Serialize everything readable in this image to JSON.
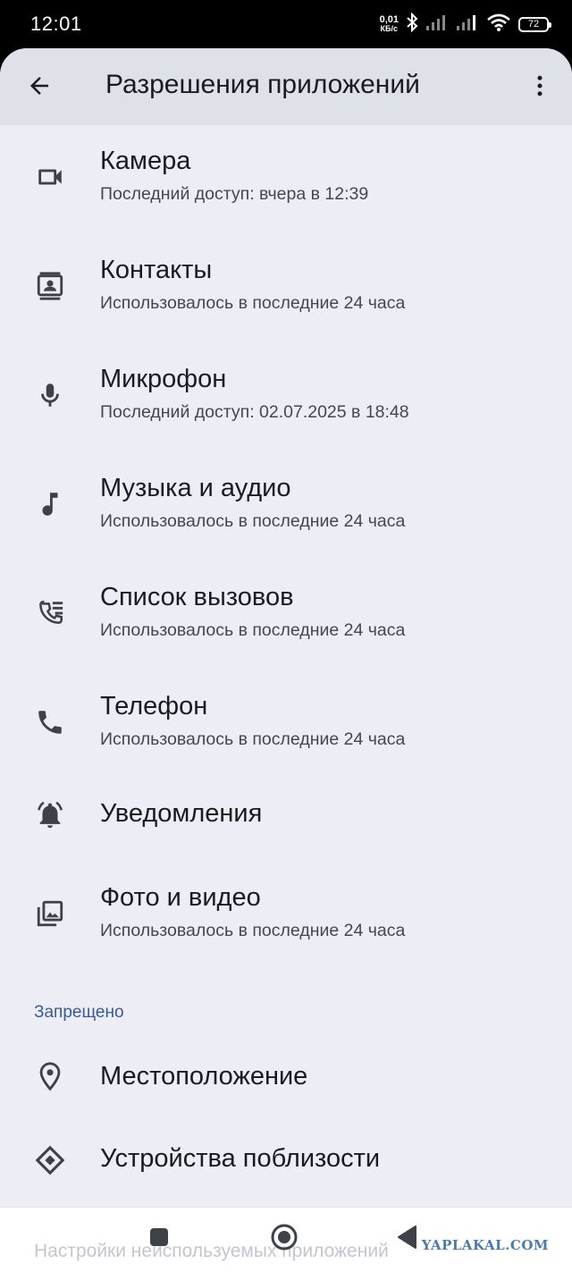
{
  "status_bar": {
    "time": "12:01",
    "net_speed_value": "0,01",
    "net_speed_unit": "КБ/с",
    "battery_level": "72",
    "icons": [
      "bluetooth-icon",
      "signal-icon",
      "signal-icon",
      "wifi-icon",
      "battery-icon"
    ]
  },
  "header": {
    "title": "Разрешения приложений",
    "back_icon": "arrow-back-icon",
    "menu_icon": "more-vert-icon"
  },
  "allowed": [
    {
      "title": "Камера",
      "subtitle": "Последний доступ: вчера в 12:39",
      "icon": "camera-icon"
    },
    {
      "title": "Контакты",
      "subtitle": "Использовалось в последние 24 часа",
      "icon": "contacts-icon"
    },
    {
      "title": "Микрофон",
      "subtitle": "Последний доступ: 02.07.2025 в 18:48",
      "icon": "microphone-icon"
    },
    {
      "title": "Музыка и аудио",
      "subtitle": "Использовалось в последние 24 часа",
      "icon": "music-note-icon"
    },
    {
      "title": "Список вызовов",
      "subtitle": "Использовалось в последние 24 часа",
      "icon": "call-log-icon"
    },
    {
      "title": "Телефон",
      "subtitle": "Использовалось в последние 24 часа",
      "icon": "phone-icon"
    },
    {
      "title": "Уведомления",
      "subtitle": "",
      "icon": "notification-bell-icon"
    },
    {
      "title": "Фото и видео",
      "subtitle": "Использовалось в последние 24 часа",
      "icon": "photo-library-icon"
    }
  ],
  "denied_section": {
    "header": "Запрещено",
    "items": [
      {
        "title": "Местоположение",
        "icon": "location-pin-icon"
      },
      {
        "title": "Устройства поблизости",
        "icon": "nearby-devices-icon"
      }
    ]
  },
  "faded_item": "Настройки неиспользуемых приложений",
  "nav_bar": {
    "icons": [
      "recents-square-icon",
      "home-circle-icon",
      "back-triangle-icon"
    ]
  },
  "watermark": "YAPLAKAL.COM",
  "colors": {
    "background": "#edeef5",
    "app_bar": "#dfe1e9",
    "section_header": "#3a5a9a",
    "text_primary": "#1b1b1f",
    "text_secondary": "#45464f"
  }
}
